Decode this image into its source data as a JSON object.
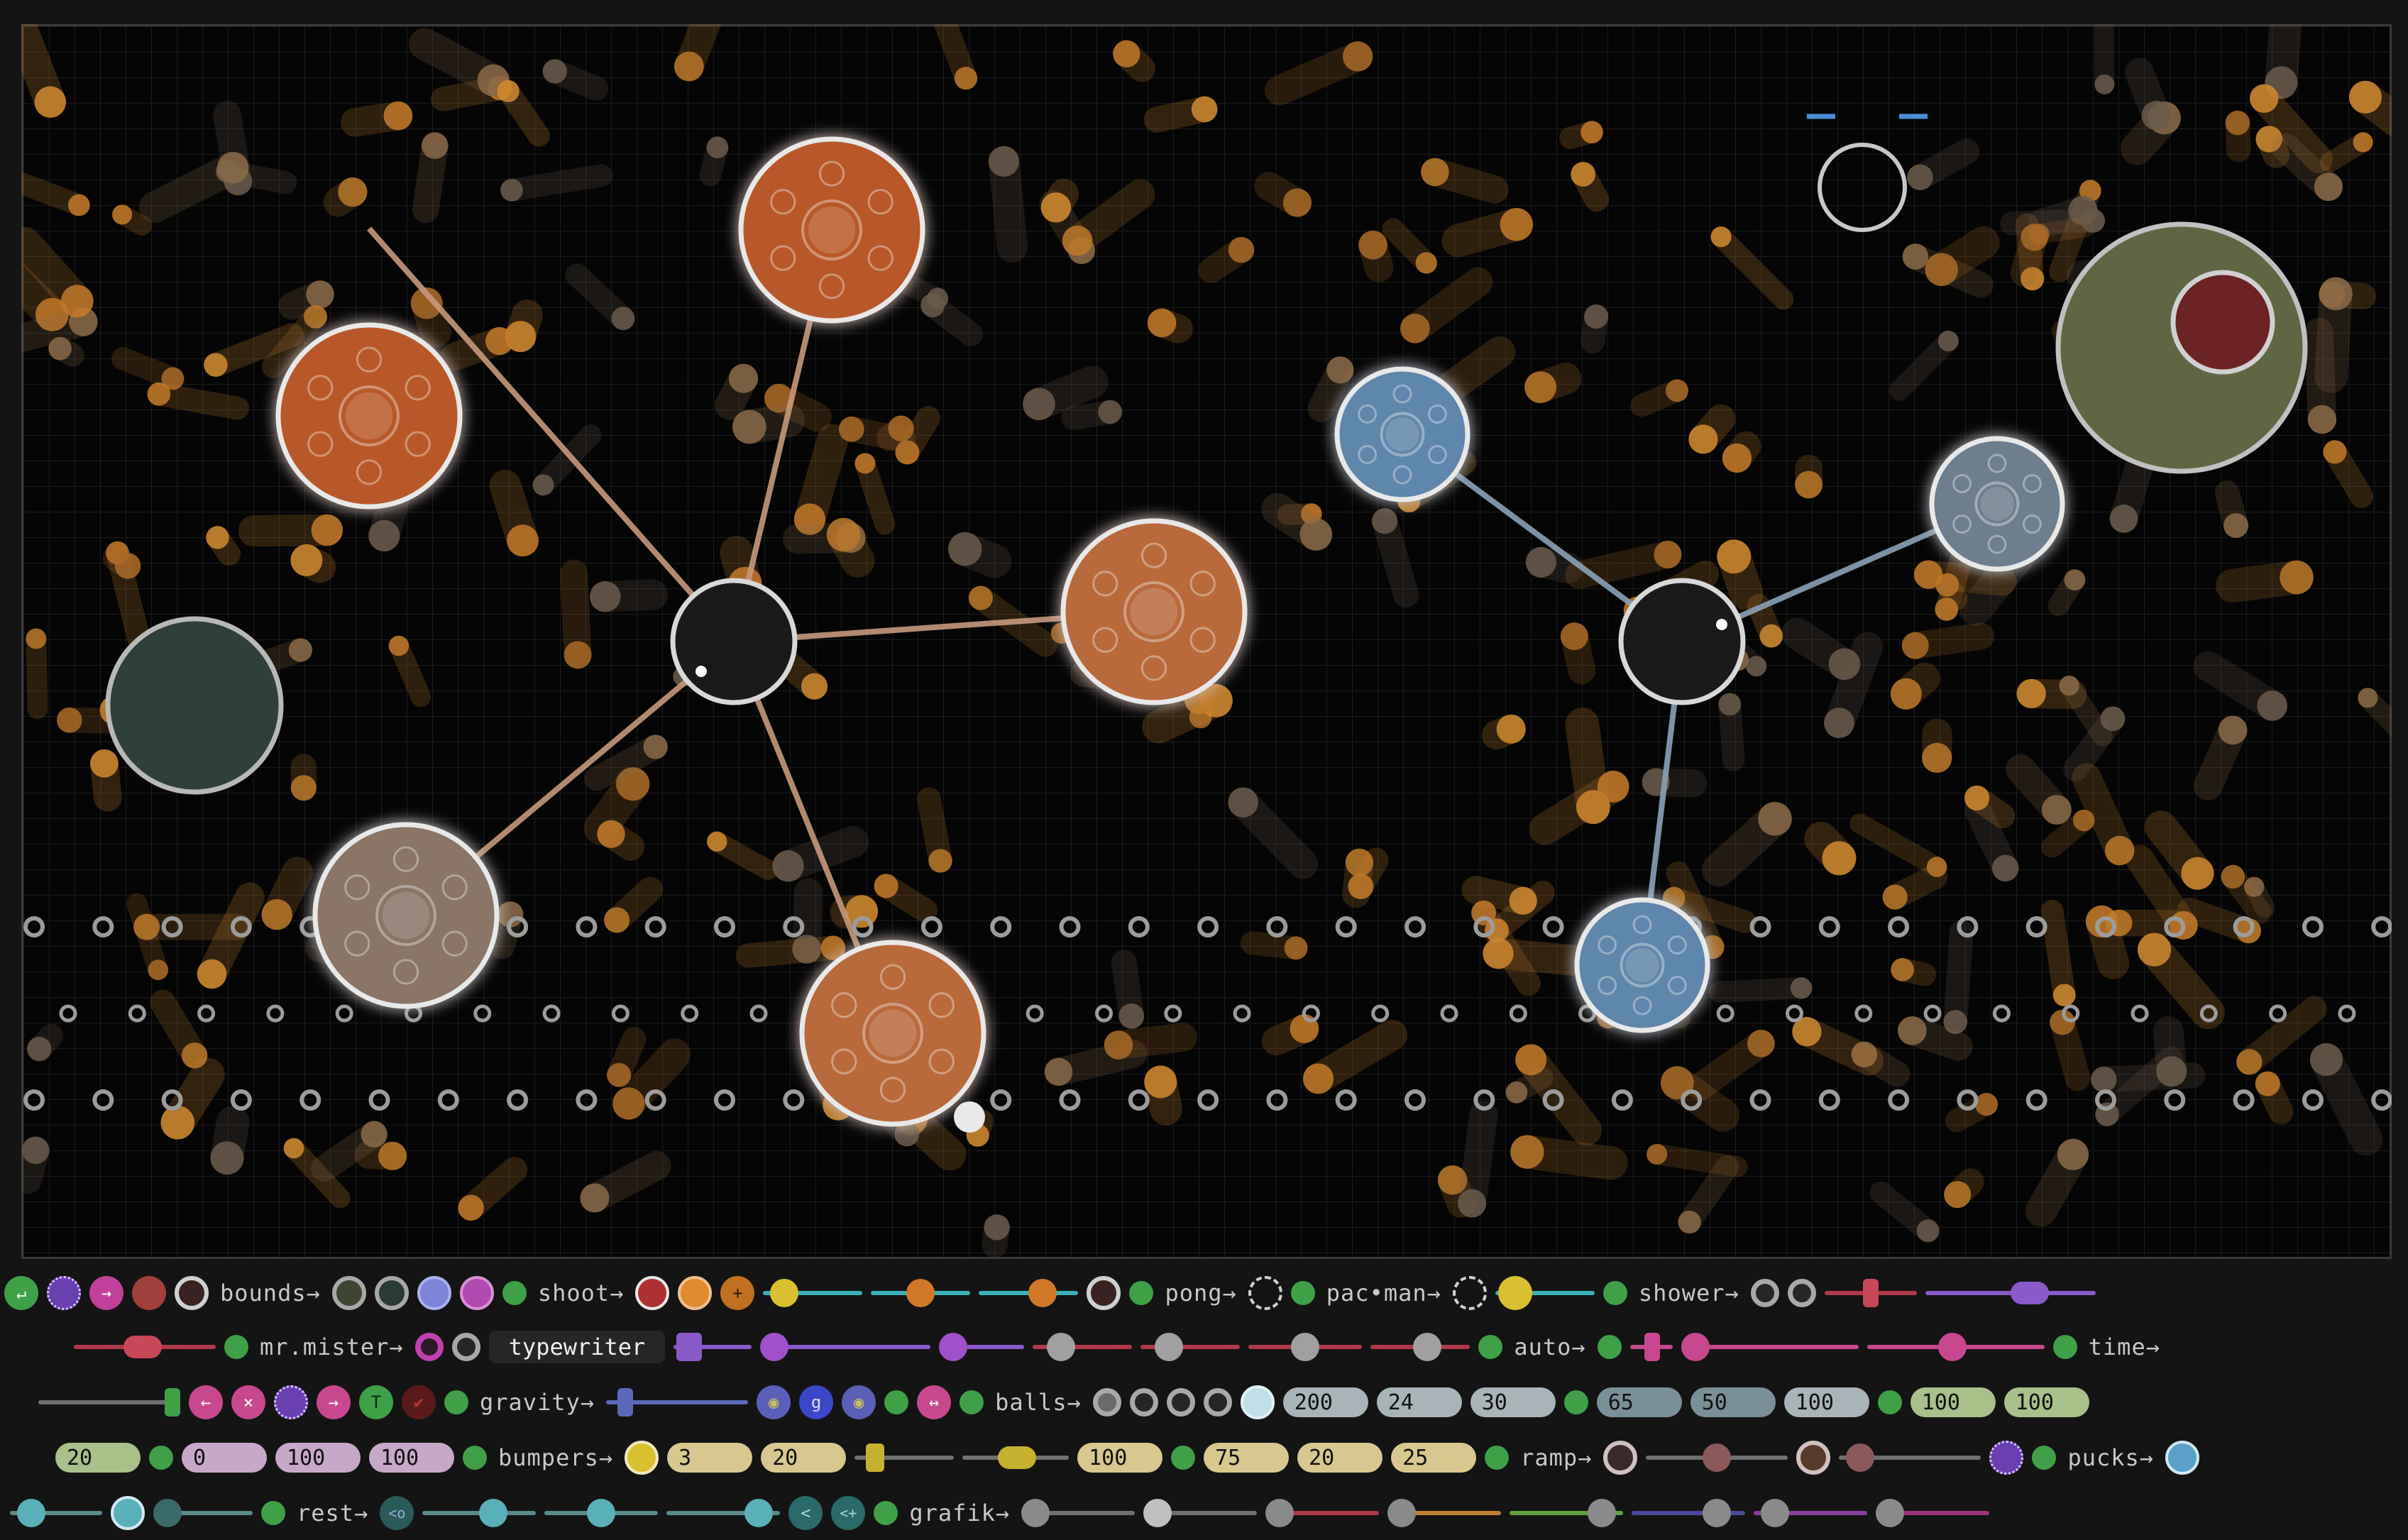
{
  "scene": {
    "colors": {
      "orange_hub": "#b8592a",
      "orange_light": "#b86a3e",
      "tan_hub": "#8a7466",
      "blue_hub": "#5f86ab",
      "slate_hub": "#6d7e8e",
      "olive": "#5f6642",
      "maroon": "#6b2323",
      "dark_teal": "#2f3f39",
      "ball": "#c27a2a",
      "pin": "#9c9c9c",
      "rope_orange": "#c7987c",
      "rope_blue": "#8aa2b8"
    }
  },
  "controls": {
    "labels": {
      "bounds": "bounds→",
      "shoot": "shoot→",
      "pong": "pong→",
      "pacman": "pac•man→",
      "shower": "shower→",
      "mr_mister": "mr.mister→",
      "typewriter": "typewriter",
      "auto": "auto→",
      "time": "time→",
      "gravity": "gravity→",
      "balls": "balls→",
      "bumpers": "bumpers→",
      "ramp": "ramp→",
      "pucks": "pucks→",
      "rest": "rest→",
      "grafik": "grafik→"
    },
    "icons": {
      "enter": "↵",
      "right_arrow": "→",
      "left_arrow": "←",
      "close": "×",
      "plus": "+",
      "t_letter": "T",
      "g_letter": "g",
      "swap": "↔",
      "back": "<",
      "back_plus": "<+",
      "back_o": "<o"
    },
    "balls_values": [
      "200",
      "24",
      "30",
      "65",
      "50",
      "100",
      "100",
      "100"
    ],
    "bumpers_values": [
      "20",
      "0",
      "100",
      "100"
    ],
    "bumpers_values_2": [
      "3",
      "20",
      "100",
      "75",
      "20",
      "25"
    ]
  }
}
